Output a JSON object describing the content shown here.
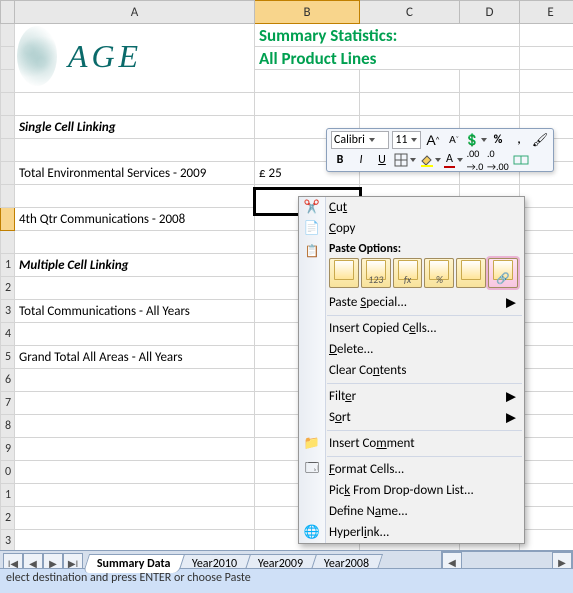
{
  "columns": [
    "",
    "A",
    "B",
    "C",
    "D",
    "E"
  ],
  "title1": "Summary Statistics:",
  "title2": "All Product Lines",
  "logo_text": "AGE",
  "section1": "Single Cell Linking",
  "row_labels": {
    "env2009": "Total Environmental Services - 2009",
    "qtr4comm": "4th Qtr Communications - 2008",
    "totcomm": "Total Communications - All Years",
    "grand": "Grand Total All Areas - All Years"
  },
  "valueB7": "£    25",
  "section2": "Multiple Cell Linking",
  "mini_toolbar": {
    "font": "Calibri",
    "size": "11",
    "button_A_big": "A",
    "button_A_small": "A",
    "pct": "%",
    "comma": ",",
    "bold": "B",
    "italic": "I",
    "underline": "A",
    "fontcolor": "A"
  },
  "context": {
    "cut": "Cut",
    "copy": "Copy",
    "paste_options": "Paste Options:",
    "paste_special": "Paste Special...",
    "insert_copied": "Insert Copied Cells...",
    "delete": "Delete...",
    "clear": "Clear Contents",
    "filter": "Filter",
    "sort": "Sort",
    "insert_comment": "Insert Comment",
    "format_cells": "Format Cells...",
    "pick_list": "Pick From Drop-down List...",
    "define_name": "Define Name...",
    "hyperlink": "Hyperlink...",
    "po_labels": [
      "",
      "123",
      "fx",
      "%",
      "",
      ""
    ]
  },
  "tabs": {
    "active": "Summary Data",
    "others": [
      "Year2010",
      "Year2009",
      "Year2008"
    ]
  },
  "status": "elect destination and press ENTER or choose Paste"
}
